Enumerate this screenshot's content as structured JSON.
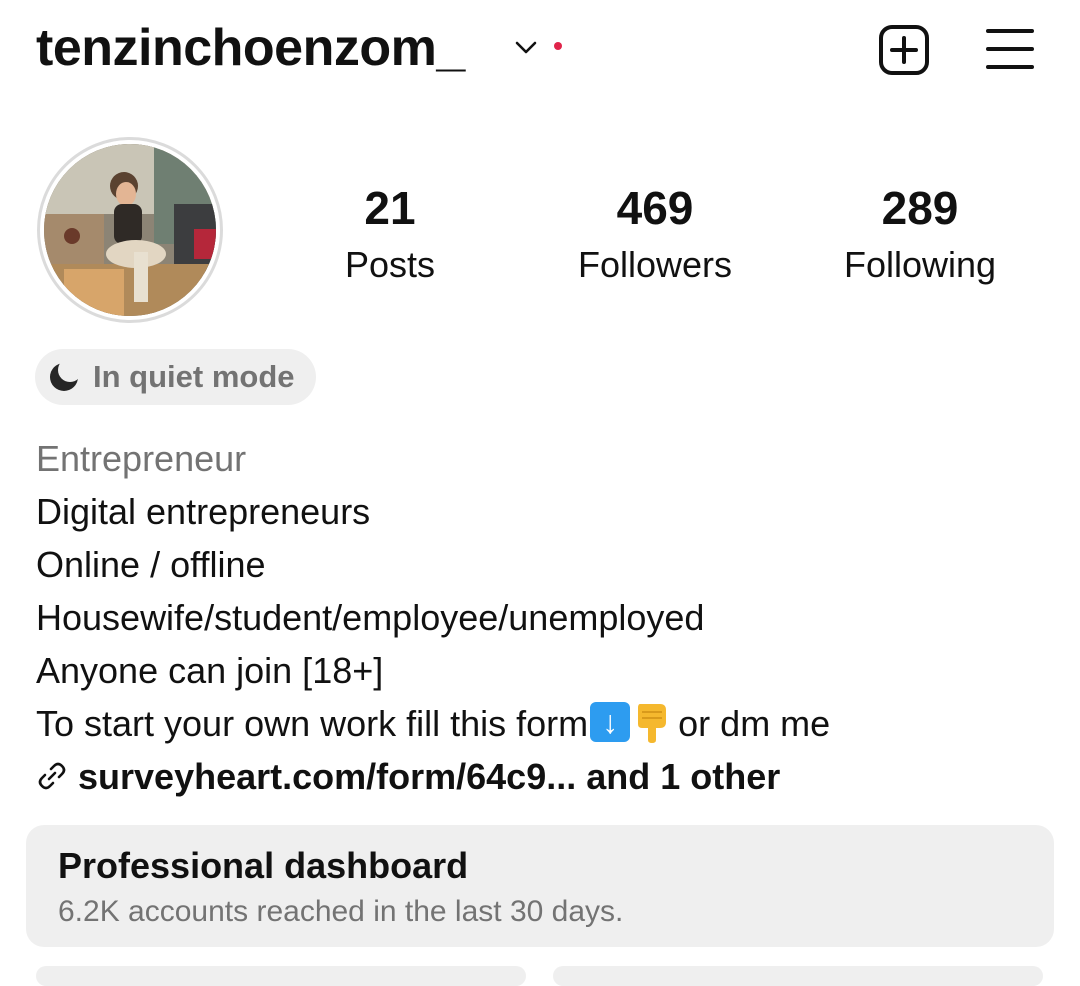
{
  "header": {
    "username": "tenzinchoenzom_",
    "icons": {
      "switch_account": "chevron-down-icon",
      "notification": "red-dot",
      "new_post": "plus-square-icon",
      "menu": "hamburger-menu-icon"
    },
    "notification_color": "#e0244a"
  },
  "profile": {
    "avatar": "profile-photo",
    "stats": [
      {
        "value": "21",
        "label": "Posts"
      },
      {
        "value": "469",
        "label": "Followers"
      },
      {
        "value": "289",
        "label": "Following"
      }
    ],
    "quiet_mode": {
      "icon": "moon-icon",
      "label": "In quiet mode"
    },
    "category": "Entrepreneur",
    "bio_lines": [
      "Digital entrepreneurs",
      "Online / offline",
      "Housewife/student/employee/unemployed",
      "Anyone can join [18+]"
    ],
    "bio_last": {
      "text_before": "To start your own work fill this form",
      "emojis": [
        "down-arrow-emoji",
        "pointing-down-emoji"
      ],
      "text_after": "or dm me"
    },
    "link": {
      "icon": "link-icon",
      "text": "surveyheart.com/form/64c9... and 1 other"
    }
  },
  "dashboard": {
    "title": "Professional dashboard",
    "subtitle": "6.2K accounts reached in the last 30 days."
  }
}
